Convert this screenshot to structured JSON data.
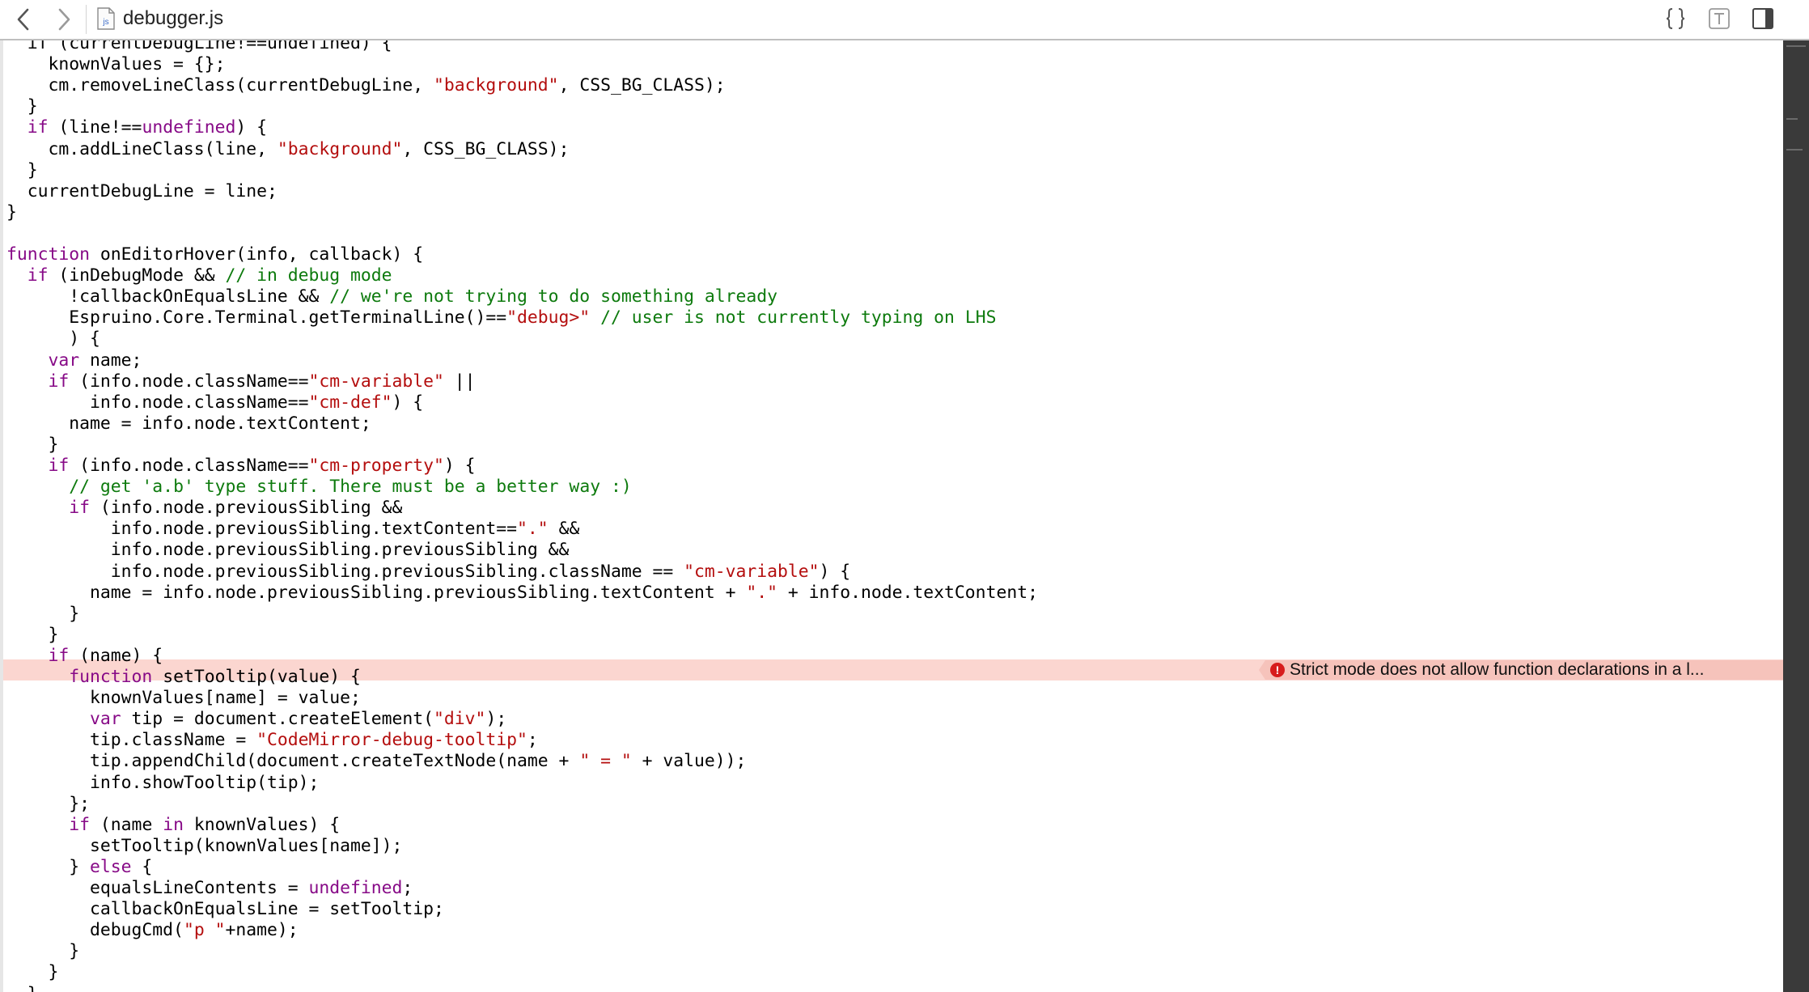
{
  "toolbar": {
    "back_icon": "chevron-left-icon",
    "forward_icon": "chevron-right-icon",
    "file_icon": "js-file-icon",
    "file_icon_label": "js",
    "file_name": "debugger.js",
    "format_icon": "curly-braces-icon",
    "type_icon": "type-profiler-icon",
    "sidebar_icon": "sidebar-toggle-icon"
  },
  "colors": {
    "keyword": "#870a87",
    "string": "#b40e0e",
    "comment": "#0d7a0d",
    "plain": "#000000",
    "error_band": "#fbd6d0",
    "error_badge": "#f6c3bb",
    "error_icon": "#d71c1c"
  },
  "error": {
    "icon": "error-exclamation-icon",
    "message": "Strict mode does not allow function declarations in a l..."
  },
  "code": [
    [
      {
        "t": "p",
        "v": "  if (currentDebugLine!==undefined) {"
      }
    ],
    [
      {
        "t": "p",
        "v": "    knownValues = {};"
      }
    ],
    [
      {
        "t": "p",
        "v": "    cm.removeLineClass(currentDebugLine, "
      },
      {
        "t": "s",
        "v": "\"background\""
      },
      {
        "t": "p",
        "v": ", CSS_BG_CLASS);"
      }
    ],
    [
      {
        "t": "p",
        "v": "  }"
      }
    ],
    [
      {
        "t": "p",
        "v": "  "
      },
      {
        "t": "k",
        "v": "if"
      },
      {
        "t": "p",
        "v": " (line!=="
      },
      {
        "t": "k",
        "v": "undefined"
      },
      {
        "t": "p",
        "v": ") {"
      }
    ],
    [
      {
        "t": "p",
        "v": "    cm.addLineClass(line, "
      },
      {
        "t": "s",
        "v": "\"background\""
      },
      {
        "t": "p",
        "v": ", CSS_BG_CLASS);"
      }
    ],
    [
      {
        "t": "p",
        "v": "  }"
      }
    ],
    [
      {
        "t": "p",
        "v": "  currentDebugLine = line;"
      }
    ],
    [
      {
        "t": "p",
        "v": "}"
      }
    ],
    [
      {
        "t": "p",
        "v": ""
      }
    ],
    [
      {
        "t": "k",
        "v": "function"
      },
      {
        "t": "p",
        "v": " onEditorHover(info, callback) {"
      }
    ],
    [
      {
        "t": "p",
        "v": "  "
      },
      {
        "t": "k",
        "v": "if"
      },
      {
        "t": "p",
        "v": " (inDebugMode && "
      },
      {
        "t": "c",
        "v": "// in debug mode"
      }
    ],
    [
      {
        "t": "p",
        "v": "      !callbackOnEqualsLine && "
      },
      {
        "t": "c",
        "v": "// we're not trying to do something already"
      }
    ],
    [
      {
        "t": "p",
        "v": "      Espruino.Core.Terminal.getTerminalLine()=="
      },
      {
        "t": "s",
        "v": "\"debug>\""
      },
      {
        "t": "p",
        "v": " "
      },
      {
        "t": "c",
        "v": "// user is not currently typing on LHS"
      }
    ],
    [
      {
        "t": "p",
        "v": "      ) {"
      }
    ],
    [
      {
        "t": "p",
        "v": "    "
      },
      {
        "t": "k",
        "v": "var"
      },
      {
        "t": "p",
        "v": " name;"
      }
    ],
    [
      {
        "t": "p",
        "v": "    "
      },
      {
        "t": "k",
        "v": "if"
      },
      {
        "t": "p",
        "v": " (info.node.className=="
      },
      {
        "t": "s",
        "v": "\"cm-variable\""
      },
      {
        "t": "p",
        "v": " ||"
      }
    ],
    [
      {
        "t": "p",
        "v": "        info.node.className=="
      },
      {
        "t": "s",
        "v": "\"cm-def\""
      },
      {
        "t": "p",
        "v": ") {"
      }
    ],
    [
      {
        "t": "p",
        "v": "      name = info.node.textContent;"
      }
    ],
    [
      {
        "t": "p",
        "v": "    }"
      }
    ],
    [
      {
        "t": "p",
        "v": "    "
      },
      {
        "t": "k",
        "v": "if"
      },
      {
        "t": "p",
        "v": " (info.node.className=="
      },
      {
        "t": "s",
        "v": "\"cm-property\""
      },
      {
        "t": "p",
        "v": ") {"
      }
    ],
    [
      {
        "t": "p",
        "v": "      "
      },
      {
        "t": "c",
        "v": "// get 'a.b' type stuff. There must be a better way :)"
      }
    ],
    [
      {
        "t": "p",
        "v": "      "
      },
      {
        "t": "k",
        "v": "if"
      },
      {
        "t": "p",
        "v": " (info.node.previousSibling &&"
      }
    ],
    [
      {
        "t": "p",
        "v": "          info.node.previousSibling.textContent=="
      },
      {
        "t": "s",
        "v": "\".\""
      },
      {
        "t": "p",
        "v": " &&"
      }
    ],
    [
      {
        "t": "p",
        "v": "          info.node.previousSibling.previousSibling &&"
      }
    ],
    [
      {
        "t": "p",
        "v": "          info.node.previousSibling.previousSibling.className == "
      },
      {
        "t": "s",
        "v": "\"cm-variable\""
      },
      {
        "t": "p",
        "v": ") {"
      }
    ],
    [
      {
        "t": "p",
        "v": "        name = info.node.previousSibling.previousSibling.textContent + "
      },
      {
        "t": "s",
        "v": "\".\""
      },
      {
        "t": "p",
        "v": " + info.node.textContent;"
      }
    ],
    [
      {
        "t": "p",
        "v": "      }"
      }
    ],
    [
      {
        "t": "p",
        "v": "    }"
      }
    ],
    [
      {
        "t": "p",
        "v": "    "
      },
      {
        "t": "k",
        "v": "if"
      },
      {
        "t": "p",
        "v": " (name) {"
      }
    ],
    [
      {
        "t": "p",
        "v": "      "
      },
      {
        "t": "k",
        "v": "function"
      },
      {
        "t": "p",
        "v": " setTooltip(value) {"
      }
    ],
    [
      {
        "t": "p",
        "v": "        knownValues[name] = value;"
      }
    ],
    [
      {
        "t": "p",
        "v": "        "
      },
      {
        "t": "k",
        "v": "var"
      },
      {
        "t": "p",
        "v": " tip = document.createElement("
      },
      {
        "t": "s",
        "v": "\"div\""
      },
      {
        "t": "p",
        "v": ");"
      }
    ],
    [
      {
        "t": "p",
        "v": "        tip.className = "
      },
      {
        "t": "s",
        "v": "\"CodeMirror-debug-tooltip\""
      },
      {
        "t": "p",
        "v": ";"
      }
    ],
    [
      {
        "t": "p",
        "v": "        tip.appendChild(document.createTextNode(name + "
      },
      {
        "t": "s",
        "v": "\" = \""
      },
      {
        "t": "p",
        "v": " + value));"
      }
    ],
    [
      {
        "t": "p",
        "v": "        info.showTooltip(tip);"
      }
    ],
    [
      {
        "t": "p",
        "v": "      };"
      }
    ],
    [
      {
        "t": "p",
        "v": "      "
      },
      {
        "t": "k",
        "v": "if"
      },
      {
        "t": "p",
        "v": " (name "
      },
      {
        "t": "k",
        "v": "in"
      },
      {
        "t": "p",
        "v": " knownValues) {"
      }
    ],
    [
      {
        "t": "p",
        "v": "        setTooltip(knownValues[name]);"
      }
    ],
    [
      {
        "t": "p",
        "v": "      } "
      },
      {
        "t": "k",
        "v": "else"
      },
      {
        "t": "p",
        "v": " {"
      }
    ],
    [
      {
        "t": "p",
        "v": "        equalsLineContents = "
      },
      {
        "t": "k",
        "v": "undefined"
      },
      {
        "t": "p",
        "v": ";"
      }
    ],
    [
      {
        "t": "p",
        "v": "        callbackOnEqualsLine = setTooltip;"
      }
    ],
    [
      {
        "t": "p",
        "v": "        debugCmd("
      },
      {
        "t": "s",
        "v": "\"p \""
      },
      {
        "t": "p",
        "v": "+name);"
      }
    ],
    [
      {
        "t": "p",
        "v": "      }"
      }
    ],
    [
      {
        "t": "p",
        "v": "    }"
      }
    ],
    [
      {
        "t": "p",
        "v": "  }"
      }
    ]
  ]
}
